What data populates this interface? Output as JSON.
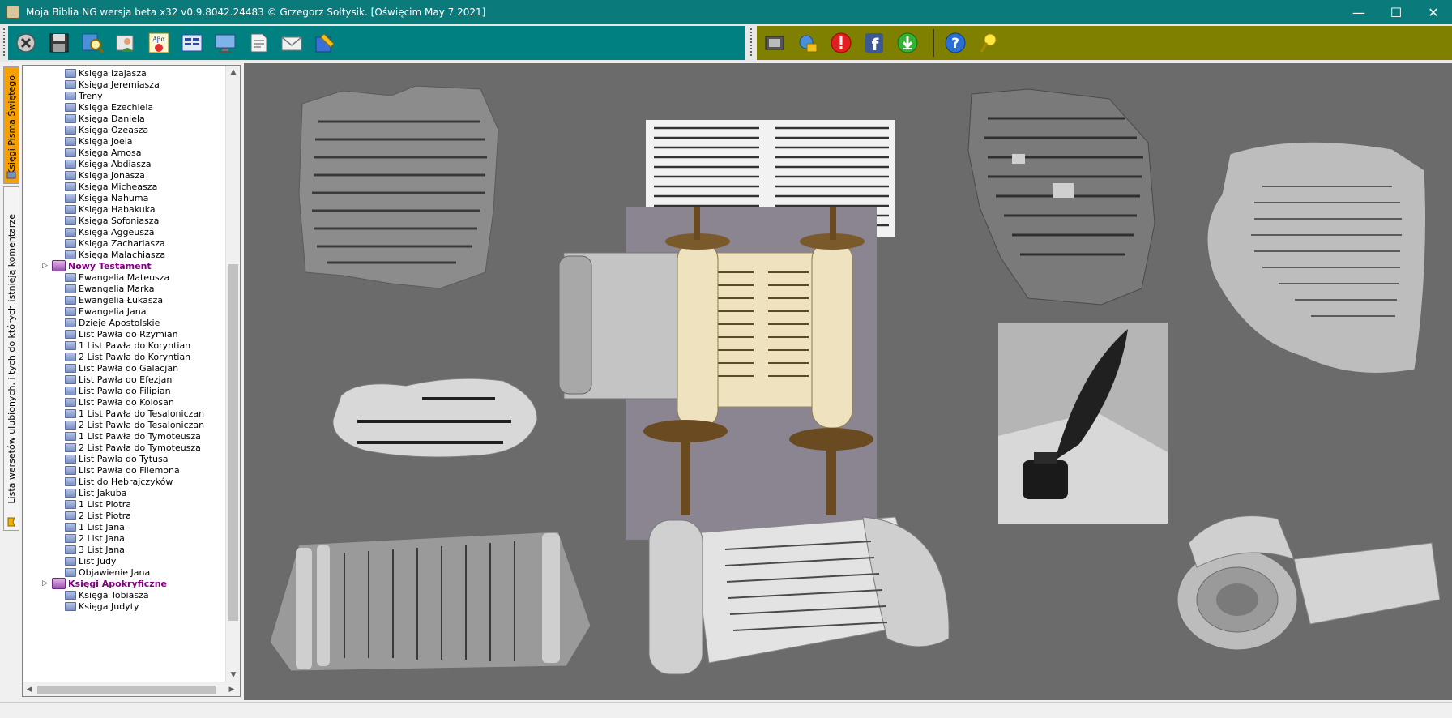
{
  "window": {
    "title": "Moja Biblia NG wersja beta x32 v0.9.8042.24483 © Grzegorz Sołtysik. [Oświęcim May  7 2021]",
    "controls": {
      "minimize": "—",
      "maximize": "☐",
      "close": "✕"
    }
  },
  "toolbar": {
    "left_color": "#008080",
    "right_color": "#808000",
    "left_icons": [
      "exit-icon",
      "save-icon",
      "search-icon",
      "user-icon",
      "greek-dictionary-icon",
      "compare-icon",
      "monitor-icon",
      "notes-icon",
      "mail-icon",
      "tools-icon"
    ],
    "right_icons": [
      "film-icon",
      "download-settings-icon",
      "alert-icon",
      "facebook-icon",
      "update-icon",
      "help-icon",
      "tip-icon"
    ]
  },
  "vtabs": {
    "books_tab": "Księgi Pisma Świętego",
    "favorites_tab": "Lista wersetów ulubionych, i tych do których istnieją komentarze"
  },
  "tree": {
    "ot_books": [
      "Księga Izajasza",
      "Księga Jeremiasza",
      "Treny",
      "Księga Ezechiela",
      "Księga Daniela",
      "Księga Ozeasza",
      "Księga Joela",
      "Księga Amosa",
      "Księga Abdiasza",
      "Księga Jonasza",
      "Księga Micheasza",
      "Księga Nahuma",
      "Księga Habakuka",
      "Księga Sofoniasza",
      "Księga Aggeusza",
      "Księga Zachariasza",
      "Księga Malachiasza"
    ],
    "nt_group": "Nowy Testament",
    "nt_books": [
      "Ewangelia Mateusza",
      "Ewangelia Marka",
      "Ewangelia Łukasza",
      "Ewangelia Jana",
      "Dzieje Apostolskie",
      "List Pawła do Rzymian",
      "1 List Pawła do Koryntian",
      "2 List Pawła do Koryntian",
      "List Pawła do Galacjan",
      "List Pawła do Efezjan",
      "List Pawła do Filipian",
      "List Pawła do Kolosan",
      "1 List Pawła do Tesaloniczan",
      "2 List Pawła do Tesaloniczan",
      "1 List Pawła do Tymoteusza",
      "2 List Pawła do Tymoteusza",
      "List Pawła do Tytusa",
      "List Pawła do Filemona",
      "List do Hebrajczyków",
      "List Jakuba",
      "1 List Piotra",
      "2 List Piotra",
      "1 List Jana",
      "2 List Jana",
      "3 List Jana",
      "List Judy",
      "Objawienie Jana"
    ],
    "apo_group": "Księgi Apokryficzne",
    "apo_books": [
      "Księga Tobiasza",
      "Księga Judyty"
    ]
  },
  "content": {
    "background": "#6b6b6b"
  }
}
